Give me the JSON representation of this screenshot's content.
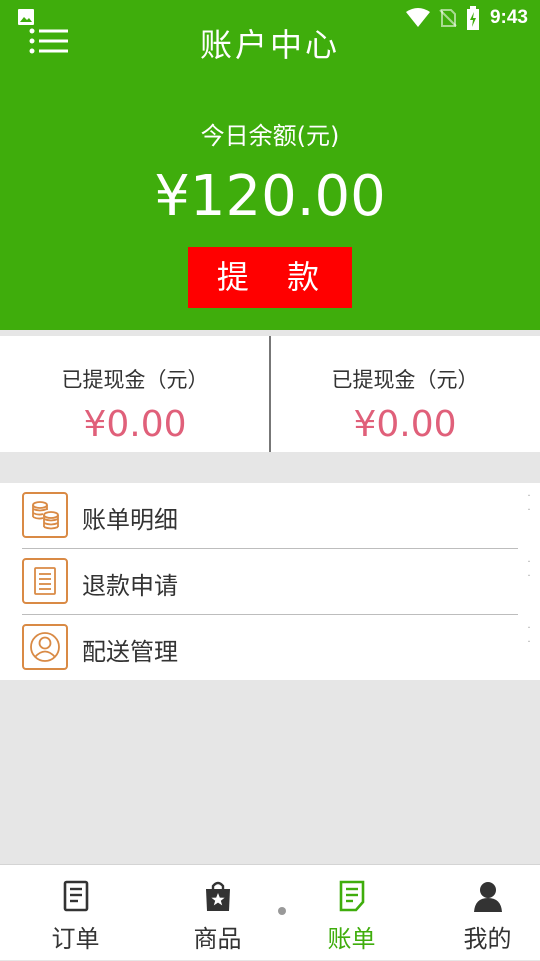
{
  "status_bar": {
    "time": "9:43",
    "icons": [
      "gallery-icon",
      "wifi-icon",
      "no-sim-icon",
      "battery-charging-icon"
    ]
  },
  "app_bar": {
    "title": "账户中心",
    "menu_icon": "menu-list-icon"
  },
  "balance": {
    "label": "今日余额(元)",
    "value": "¥120.00",
    "withdraw_label": "提 款"
  },
  "stats": [
    {
      "label": "已提现金（元）",
      "value": "¥0.00"
    },
    {
      "label": "已提现金（元）",
      "value": "¥0.00"
    }
  ],
  "menu": [
    {
      "label": "账单明细",
      "icon": "coins-icon"
    },
    {
      "label": "退款申请",
      "icon": "document-icon"
    },
    {
      "label": "配送管理",
      "icon": "user-profile-icon"
    }
  ],
  "nav": [
    {
      "label": "订单",
      "icon": "order-icon",
      "active": false
    },
    {
      "label": "商品",
      "icon": "shopping-bag-icon",
      "active": false
    },
    {
      "label": "账单",
      "icon": "bill-icon",
      "active": true
    },
    {
      "label": "我的",
      "icon": "person-icon",
      "active": false
    }
  ],
  "colors": {
    "primary": "#3fad0c",
    "withdraw_button": "#ff0000",
    "amount": "#e0607a",
    "menu_icon": "#d98a45",
    "background": "#e6e6e6"
  }
}
